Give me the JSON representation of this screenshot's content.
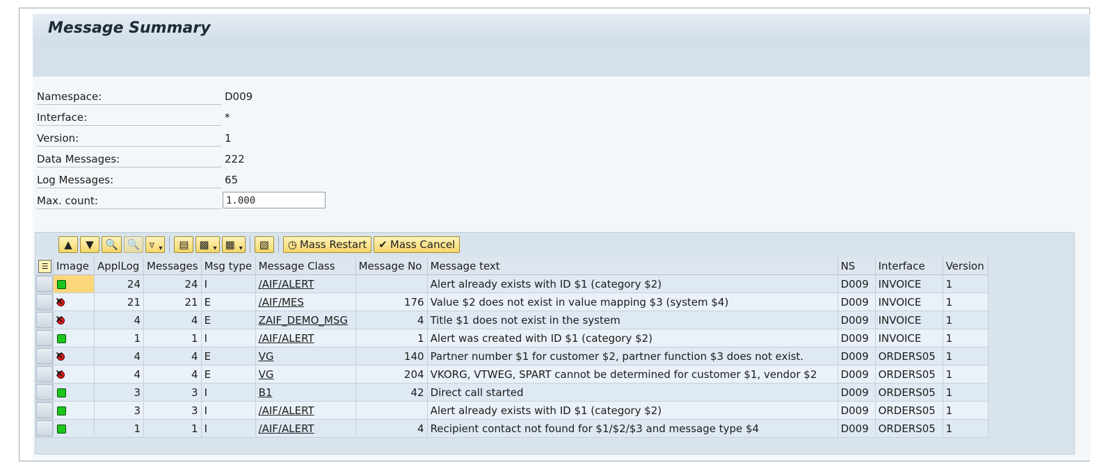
{
  "window": {
    "title": "Message Summary"
  },
  "fields": [
    {
      "label": "Namespace:",
      "value": "D009"
    },
    {
      "label": "Interface:",
      "value": "*"
    },
    {
      "label": "Version:",
      "value": "1"
    },
    {
      "label": "Data Messages:",
      "value": "222"
    },
    {
      "label": "Log Messages:",
      "value": "65"
    }
  ],
  "max_count": {
    "label": "Max. count:",
    "value": "1.000"
  },
  "toolbar": {
    "icons": [
      "details-icon",
      "sort-ascending-icon",
      "find-icon",
      "find-next-icon",
      "filter-icon",
      "print-preview-icon",
      "export-icon",
      "layout-icon",
      "abc-analysis-icon"
    ],
    "mass_restart": "Mass Restart",
    "mass_cancel": "Mass Cancel"
  },
  "table": {
    "columns": [
      "Image",
      "ApplLog",
      "Messages",
      "Msg type",
      "Message Class",
      "Message No",
      "Message text",
      "NS",
      "Interface",
      "Version"
    ],
    "rows": [
      {
        "status": "green",
        "appllog": "24",
        "messages": "24",
        "msgtype": "I",
        "msgclass": "/AIF/ALERT",
        "msgno": "",
        "text": "Alert already exists with ID $1 (category $2)",
        "ns": "D009",
        "interface": "INVOICE",
        "version": "1"
      },
      {
        "status": "red",
        "appllog": "21",
        "messages": "21",
        "msgtype": "E",
        "msgclass": "/AIF/MES",
        "msgno": "176",
        "text": "Value $2 does not exist in value mapping $3 (system $4)",
        "ns": "D009",
        "interface": "INVOICE",
        "version": "1"
      },
      {
        "status": "red",
        "appllog": "4",
        "messages": "4",
        "msgtype": "E",
        "msgclass": "ZAIF_DEMO_MSG",
        "msgno": "4",
        "text": "Title $1 does not exist in the system",
        "ns": "D009",
        "interface": "INVOICE",
        "version": "1"
      },
      {
        "status": "green",
        "appllog": "1",
        "messages": "1",
        "msgtype": "I",
        "msgclass": "/AIF/ALERT",
        "msgno": "1",
        "text": "Alert was created with ID $1 (category $2)",
        "ns": "D009",
        "interface": "INVOICE",
        "version": "1"
      },
      {
        "status": "red",
        "appllog": "4",
        "messages": "4",
        "msgtype": "E",
        "msgclass": "VG",
        "msgno": "140",
        "text": "Partner number $1 for customer $2, partner function $3 does not exist.",
        "ns": "D009",
        "interface": "ORDERS05",
        "version": "1"
      },
      {
        "status": "red",
        "appllog": "4",
        "messages": "4",
        "msgtype": "E",
        "msgclass": "VG",
        "msgno": "204",
        "text": "VKORG, VTWEG, SPART cannot be determined for customer $1, vendor $2",
        "ns": "D009",
        "interface": "ORDERS05",
        "version": "1"
      },
      {
        "status": "green",
        "appllog": "3",
        "messages": "3",
        "msgtype": "I",
        "msgclass": "B1",
        "msgno": "42",
        "text": "Direct call started",
        "ns": "D009",
        "interface": "ORDERS05",
        "version": "1"
      },
      {
        "status": "green",
        "appllog": "3",
        "messages": "3",
        "msgtype": "I",
        "msgclass": "/AIF/ALERT",
        "msgno": "",
        "text": "Alert already exists with ID $1 (category $2)",
        "ns": "D009",
        "interface": "ORDERS05",
        "version": "1"
      },
      {
        "status": "green",
        "appllog": "1",
        "messages": "1",
        "msgtype": "I",
        "msgclass": "/AIF/ALERT",
        "msgno": "4",
        "text": "Recipient contact not found for $1/$2/$3 and message type $4",
        "ns": "D009",
        "interface": "ORDERS05",
        "version": "1"
      }
    ]
  }
}
